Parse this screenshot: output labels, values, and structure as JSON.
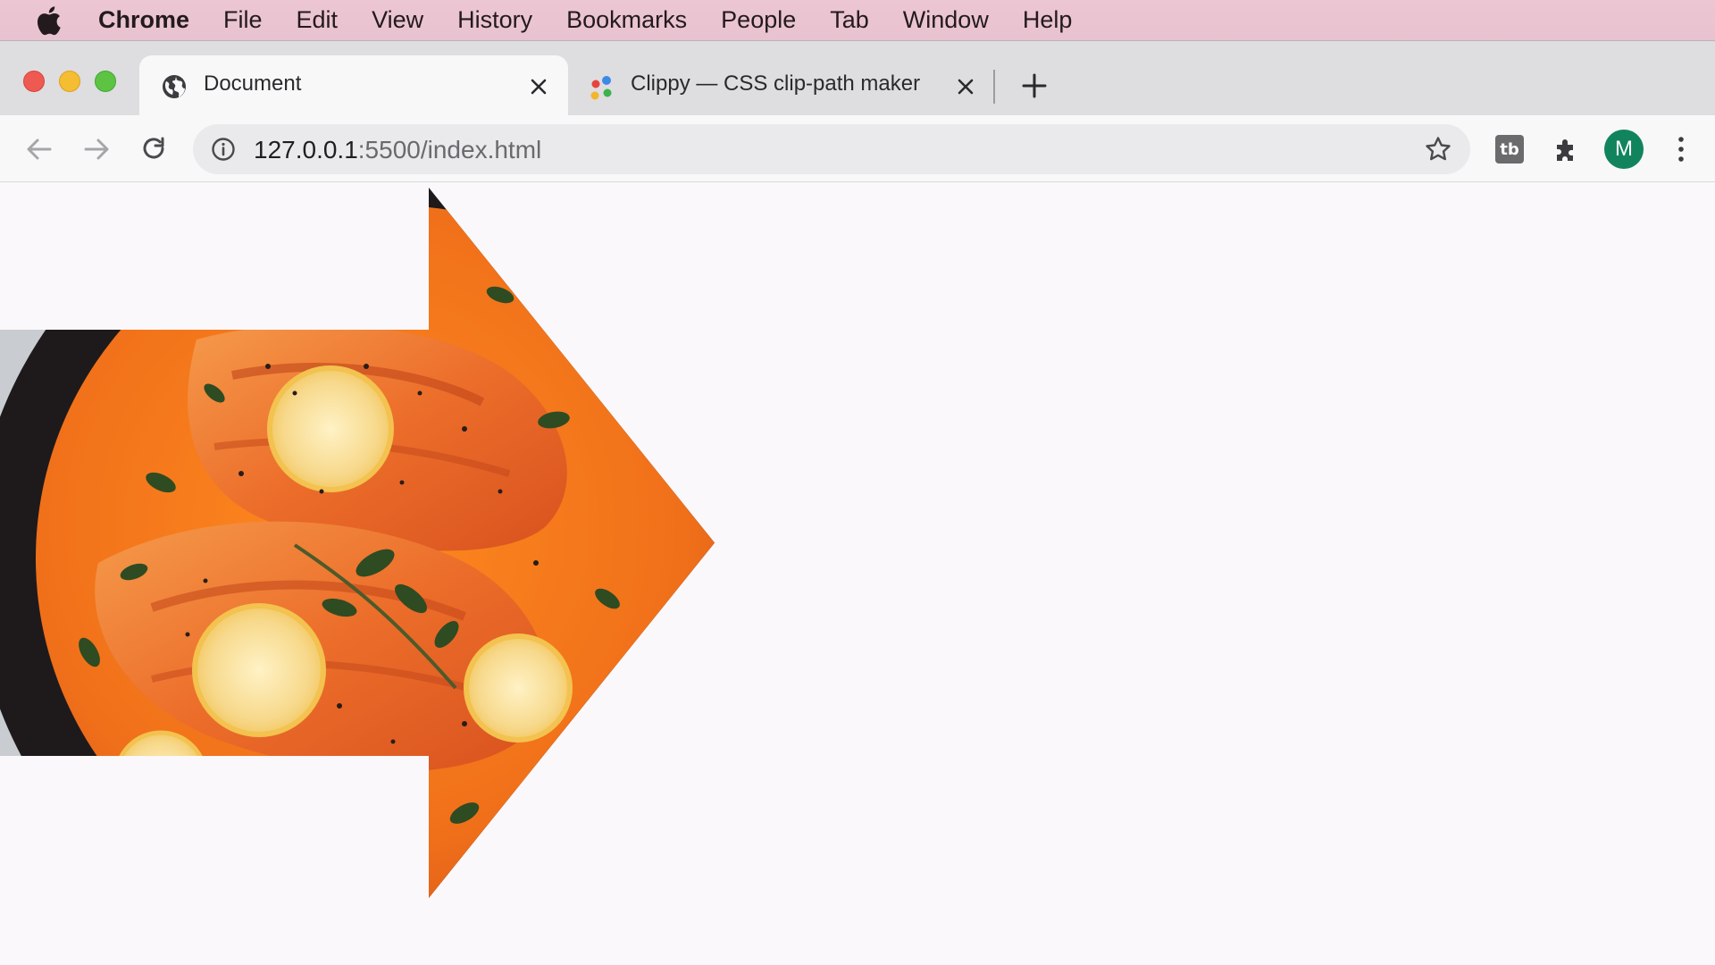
{
  "menubar": {
    "app_name": "Chrome",
    "items": [
      "File",
      "Edit",
      "View",
      "History",
      "Bookmarks",
      "People",
      "Tab",
      "Window",
      "Help"
    ]
  },
  "tabs": [
    {
      "title": "Document",
      "active": true,
      "icon": "globe-icon"
    },
    {
      "title": "Clippy — CSS clip-path maker",
      "active": false,
      "icon": "clippy-favicon-icon"
    }
  ],
  "toolbar": {
    "url_host": "127.0.0.1",
    "url_rest": ":5500/index.html",
    "avatar_letter": "M",
    "extension_label": "tb"
  },
  "colors": {
    "menubar": "#ecc6d3",
    "tabstrip": "#dedde0",
    "page_bg": "#faf8fa",
    "avatar": "#11845e",
    "sauce": "#f47a18",
    "pan": "#1e1a1b"
  },
  "content": {
    "image": "salmon-dish-image",
    "shape": "right-arrow-clip-path"
  }
}
